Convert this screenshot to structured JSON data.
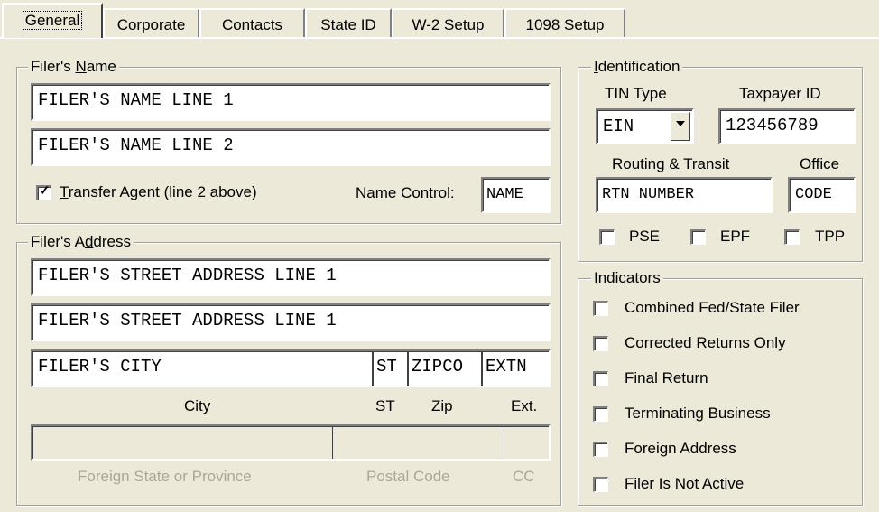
{
  "tabs": [
    {
      "label": "General",
      "active": true
    },
    {
      "label": "Corporate"
    },
    {
      "label": "Contacts"
    },
    {
      "label": "State ID"
    },
    {
      "label": "W-2 Setup"
    },
    {
      "label": "1098 Setup"
    }
  ],
  "filers_name": {
    "legend_pre": "Filer's ",
    "legend_acc": "N",
    "legend_post": "ame",
    "line1": "FILER'S NAME LINE 1",
    "line2": "FILER'S NAME LINE 2",
    "transfer_agent_checked": true,
    "transfer_agent_acc": "T",
    "transfer_agent_label": "ransfer Agent (line 2 above)",
    "name_control_label": "Name Control:",
    "name_control_value": "NAME"
  },
  "filers_address": {
    "legend_pre": "Filer's A",
    "legend_acc": "d",
    "legend_post": "dress",
    "street1": "FILER'S STREET ADDRESS LINE 1",
    "street2": "FILER'S STREET ADDRESS LINE 1",
    "city": "FILER'S CITY",
    "st": "ST",
    "zip": "ZIPCO",
    "ext": "EXTN",
    "city_label": "City",
    "st_label": "ST",
    "zip_label": "Zip",
    "ext_label": "Ext.",
    "foreign_state_label": "Foreign State or Province",
    "postal_code_label": "Postal Code",
    "cc_label": "CC"
  },
  "identification": {
    "legend_acc": "I",
    "legend_post": "dentification",
    "tin_type_label": "TIN Type",
    "tin_type_value": "EIN",
    "taxpayer_id_label": "Taxpayer ID",
    "taxpayer_id_value": "123456789",
    "routing_label": "Routing & Transit",
    "routing_value": "RTN NUMBER",
    "office_label": "Office",
    "office_value": "CODE",
    "pse_label": "PSE",
    "epf_label": "EPF",
    "tpp_label": "TPP"
  },
  "indicators": {
    "legend_pre": "Indi",
    "legend_acc": "c",
    "legend_post": "ators",
    "items": [
      {
        "label": "Combined Fed/State Filer",
        "checked": false
      },
      {
        "label": "Corrected Returns Only",
        "checked": false
      },
      {
        "label": "Final Return",
        "checked": false
      },
      {
        "label": "Terminating Business",
        "checked": false
      },
      {
        "label": "Foreign Address",
        "checked": false
      },
      {
        "label": "Filer Is Not Active",
        "checked": false
      }
    ]
  }
}
